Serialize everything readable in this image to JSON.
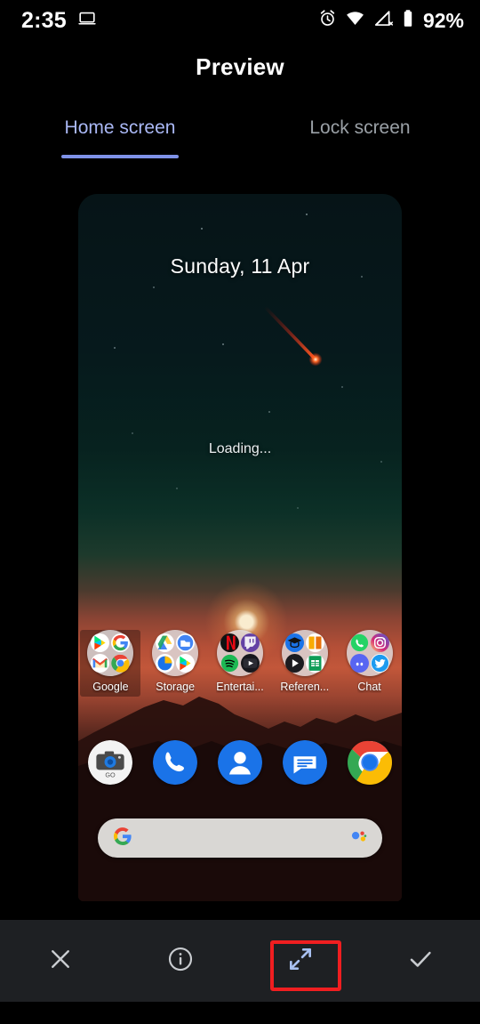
{
  "statusbar": {
    "time": "2:35",
    "cast_icon": "laptop-cast-icon",
    "alarm_icon": "alarm-clock-icon",
    "wifi_icon": "wifi-icon",
    "cellular_icon": "cellular-no-service-icon",
    "battery_icon": "battery-icon",
    "battery_percent": "92%"
  },
  "header": {
    "title": "Preview"
  },
  "tabs": [
    {
      "label": "Home screen",
      "active": true
    },
    {
      "label": "Lock screen",
      "active": false
    }
  ],
  "preview": {
    "date_widget": "Sunday, 11 Apr",
    "loading_text": "Loading...",
    "wallpaper_description": "night-to-sunset landscape with meteor",
    "folders": [
      {
        "label": "Google",
        "selected": true,
        "apps": [
          "play-store-icon",
          "google-search-icon",
          "gmail-icon",
          "chrome-icon"
        ]
      },
      {
        "label": "Storage",
        "selected": false,
        "apps": [
          "drive-icon",
          "files-icon",
          "photos-icon",
          "play-store-icon"
        ]
      },
      {
        "label": "Entertai...",
        "selected": false,
        "apps": [
          "netflix-icon",
          "twitch-icon",
          "spotify-icon",
          "youtube-icon"
        ]
      },
      {
        "label": "Referen...",
        "selected": false,
        "apps": [
          "classroom-icon",
          "books-icon",
          "play-video-icon",
          "sheets-icon"
        ]
      },
      {
        "label": "Chat",
        "selected": false,
        "apps": [
          "whatsapp-icon",
          "instagram-icon",
          "discord-icon",
          "twitter-icon"
        ]
      }
    ],
    "dock": [
      {
        "name": "camera-go-icon"
      },
      {
        "name": "phone-icon"
      },
      {
        "name": "contacts-icon"
      },
      {
        "name": "messages-icon"
      },
      {
        "name": "chrome-icon"
      }
    ],
    "search_bar": {
      "google_logo": "google-g-icon",
      "assistant_icon": "google-assistant-icon",
      "value": "",
      "placeholder": ""
    }
  },
  "toolbar": {
    "close_label": "close-icon",
    "info_label": "info-icon",
    "expand_label": "expand-fullscreen-icon",
    "confirm_label": "check-icon",
    "highlighted_item": "expand-fullscreen-icon"
  },
  "colors": {
    "accent": "#7f92e8",
    "tab_active_text": "#aab8f5",
    "tab_inactive_text": "#9aa0a6",
    "toolbar_bg": "#1e2023",
    "highlight_border": "#f01e20",
    "icon_tint": "#a8c0f0"
  }
}
